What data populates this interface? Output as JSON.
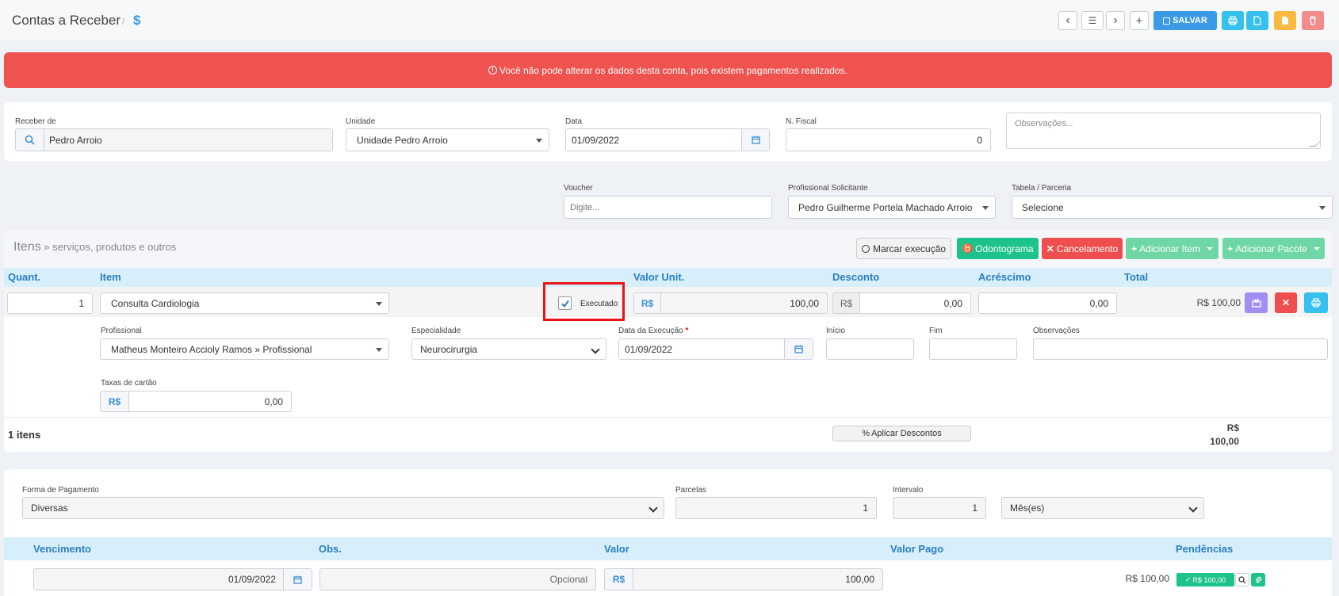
{
  "page": {
    "title": "Contas a Receber",
    "breadcrumb_sep": "/",
    "breadcrumb_icon": "$"
  },
  "toolbar": {
    "save_label": "SALVAR",
    "prev_icon": "‹",
    "list_icon": "☰",
    "next_icon": "›",
    "add_icon": "+"
  },
  "alert": {
    "text": "Você não pode alterar os dados desta conta, pois existem pagamentos realizados."
  },
  "account": {
    "receber_de_label": "Receber de",
    "receber_de_value": "Pedro Arroio",
    "unidade_label": "Unidade",
    "unidade_value": "Unidade Pedro Arroio",
    "data_label": "Data",
    "data_value": "01/09/2022",
    "nfiscal_label": "N. Fiscal",
    "nfiscal_value": "0",
    "obs_placeholder": "Observações..."
  },
  "extra": {
    "voucher_label": "Voucher",
    "voucher_placeholder": "Digite...",
    "prof_solic_label": "Profissional Solicitante",
    "prof_solic_value": "Pedro Guilherme Portela Machado Arroio",
    "tabela_label": "Tabela / Parceria",
    "tabela_value": "Selecione"
  },
  "items": {
    "title": "Itens",
    "subtitle": " » serviços, produtos e outros",
    "btn_marcar": "Marcar execução",
    "btn_odontograma": "Odontograma",
    "btn_cancelamento": "Cancelamento",
    "btn_add_item": "Adicionar Item",
    "btn_add_pacote": "Adicionar Pacote",
    "col_quant": "Quant.",
    "col_item": "Item",
    "col_valor_unit": "Valor Unit.",
    "col_desconto": "Desconto",
    "col_acrescimo": "Acréscimo",
    "col_total": "Total",
    "row": {
      "quant": "1",
      "item": "Consulta Cardiologia",
      "executado_label": "Executado",
      "currency": "R$",
      "valor_unit": "100,00",
      "desconto": "0,00",
      "acrescimo": "0,00",
      "total": "R$ 100,00"
    },
    "detail": {
      "profissional_label": "Profissional",
      "profissional_value": "Matheus Monteiro Accioly Ramos » Profissional",
      "especialidade_label": "Especialidade",
      "especialidade_value": "Neurocirurgia",
      "data_exec_label": "Data da Execução",
      "data_exec_required": "*",
      "data_exec_value": "01/09/2022",
      "inicio_label": "Início",
      "fim_label": "Fim",
      "obs_label": "Observações",
      "taxas_label": "Taxas de cartão",
      "taxas_value": "0,00"
    },
    "footer_count": "1 itens",
    "aplicar_descontos": "Aplicar Descontos",
    "footer_currency": "R$",
    "footer_total": "100,00"
  },
  "payment": {
    "forma_label": "Forma de Pagamento",
    "forma_value": "Diversas",
    "parcelas_label": "Parcelas",
    "parcelas_value": "1",
    "intervalo_label": "Intervalo",
    "intervalo_value": "1",
    "periodo_value": "Mês(es)",
    "col_vencimento": "Vencimento",
    "col_obs": "Obs.",
    "col_valor": "Valor",
    "col_valor_pago": "Valor Pago",
    "col_pendencias": "Pendências",
    "row": {
      "vencimento": "01/09/2022",
      "obs_placeholder": "Opcional",
      "currency": "R$",
      "valor": "100,00",
      "pendencia": "R$ 100,00",
      "badge": "R$ 100,00"
    }
  },
  "colors": {
    "alert_red": "#ef5350",
    "primary_blue": "#3a9ae8",
    "header_blue": "#d7eefb",
    "odontograma_green": "#1ec28b",
    "cancel_red": "#ef4e4e",
    "add_green": "#6fd6a6",
    "purple": "#a18ef0",
    "orange": "#f8b940",
    "highlight_red": "#e8141a"
  }
}
